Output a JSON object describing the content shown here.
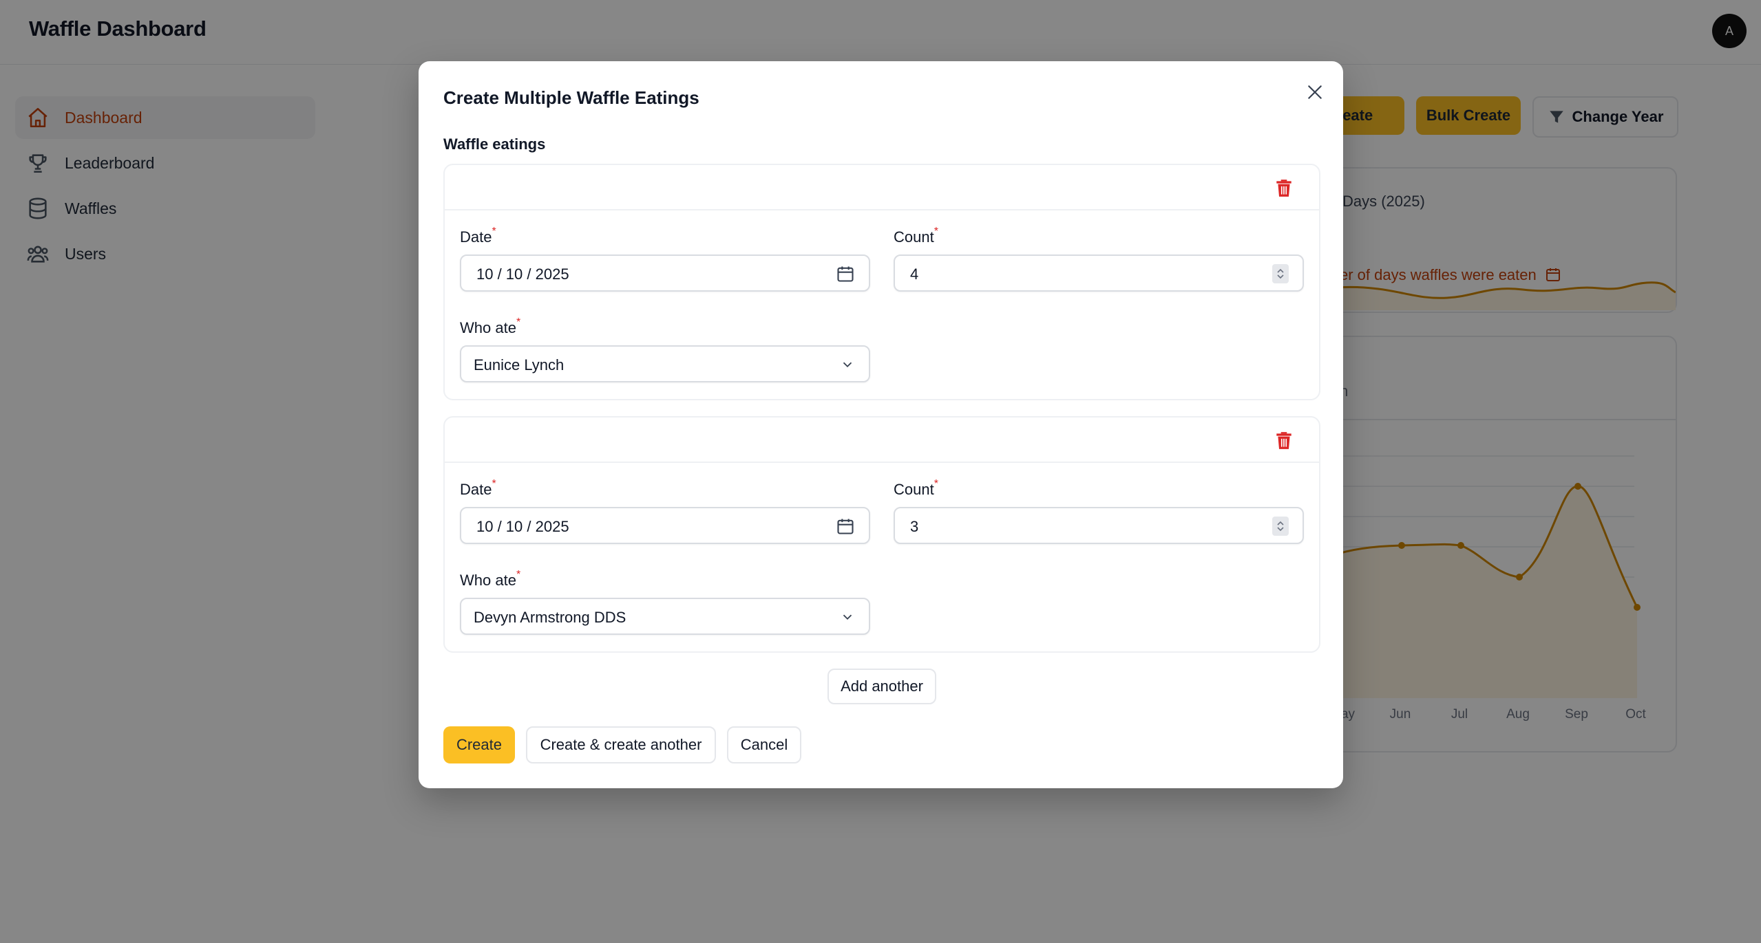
{
  "app": {
    "title": "Waffle Dashboard",
    "avatar_initial": "A"
  },
  "sidebar": {
    "items": [
      {
        "label": "Dashboard",
        "icon": "home-icon",
        "active": true
      },
      {
        "label": "Leaderboard",
        "icon": "trophy-icon",
        "active": false
      },
      {
        "label": "Waffles",
        "icon": "database-icon",
        "active": false
      },
      {
        "label": "Users",
        "icon": "users-icon",
        "active": false
      }
    ]
  },
  "toolbar": {
    "create_label": "Create",
    "bulk_create_label": "Bulk Create",
    "change_year_label": "Change Year"
  },
  "background_cards": {
    "days_title": "Days (2025)",
    "days_stat": "er of days waffles were eaten",
    "month_subtitle": "th",
    "x_ticks": [
      "ay",
      "Jun",
      "Jul",
      "Aug",
      "Sep",
      "Oct"
    ]
  },
  "modal": {
    "title": "Create Multiple Waffle Eatings",
    "section_label": "Waffle eatings",
    "entries": [
      {
        "date_label": "Date",
        "date_value": "10 / 10 / 2025",
        "count_label": "Count",
        "count_value": "4",
        "who_label": "Who ate",
        "who_value": "Eunice Lynch"
      },
      {
        "date_label": "Date",
        "date_value": "10 / 10 / 2025",
        "count_label": "Count",
        "count_value": "3",
        "who_label": "Who ate",
        "who_value": "Devyn Armstrong DDS"
      }
    ],
    "add_another_label": "Add another",
    "create_label": "Create",
    "create_another_label": "Create & create another",
    "cancel_label": "Cancel",
    "required_marker": "*"
  },
  "colors": {
    "accent": "#fbbf24",
    "active_nav": "#c2410c",
    "danger": "#dc2626",
    "chart_line": "#d08700"
  }
}
